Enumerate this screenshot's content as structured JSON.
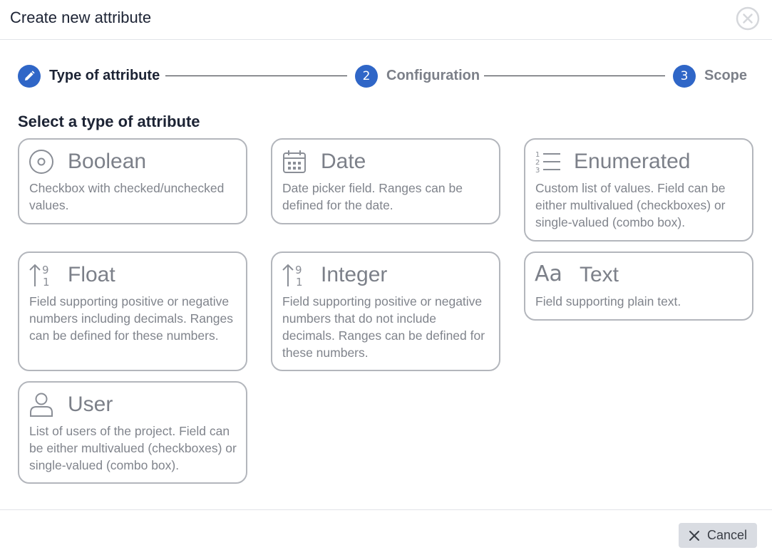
{
  "dialog": {
    "title": "Create new attribute",
    "close_icon": "close-circle-icon"
  },
  "stepper": {
    "steps": [
      {
        "icon": "pencil-icon",
        "label": "Type of attribute",
        "active": true
      },
      {
        "number": "2",
        "label": "Configuration",
        "active": false
      },
      {
        "number": "3",
        "label": "Scope",
        "active": false
      }
    ],
    "accent_color": "#2f66c7",
    "active_label_color": "#1c2334",
    "inactive_label_color": "#7c8089"
  },
  "section": {
    "title": "Select a type of attribute"
  },
  "attribute_types": [
    {
      "name": "Boolean",
      "icon": "radio-circle-icon",
      "description": "Checkbox with checked/unchecked values."
    },
    {
      "name": "Date",
      "icon": "calendar-icon",
      "description": "Date picker field. Ranges can be defined for the date."
    },
    {
      "name": "Enumerated",
      "icon": "numbered-list-icon",
      "description": "Custom list of values. Field can be either multivalued (checkboxes) or single-valued (combo box)."
    },
    {
      "name": "Float",
      "icon": "sort-numeric-icon",
      "description": "Field supporting positive or negative numbers including decimals. Ranges can be defined for these numbers."
    },
    {
      "name": "Integer",
      "icon": "sort-numeric-icon",
      "description": "Field supporting positive or negative numbers that do not include decimals. Ranges can be defined for these numbers."
    },
    {
      "name": "Text",
      "icon": "text-format-icon",
      "icon_text": "Aa",
      "description": "Field supporting plain text."
    },
    {
      "name": "User",
      "icon": "user-icon",
      "description": "List of users of the project. Field can be either multivalued (checkboxes) or single-valued (combo box)."
    }
  ],
  "footer": {
    "cancel_label": "Cancel",
    "cancel_icon": "close-icon"
  }
}
